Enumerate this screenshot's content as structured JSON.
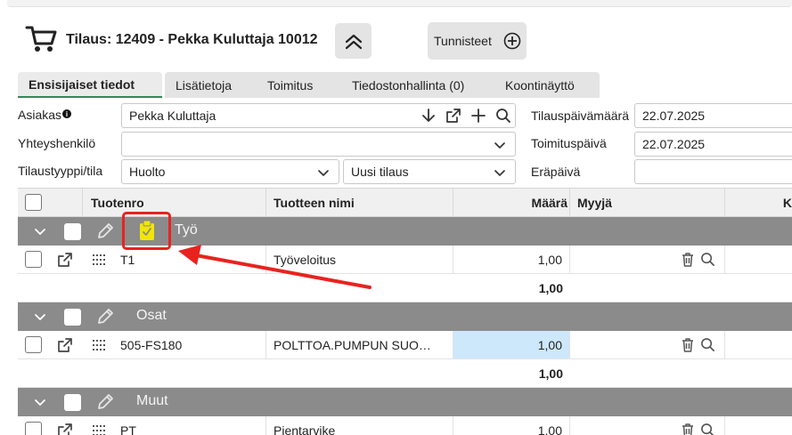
{
  "header": {
    "title": "Tilaus: 12409 - Pekka Kuluttaja 10012",
    "tags_label": "Tunnisteet"
  },
  "tabs": [
    {
      "label": "Ensisijaiset tiedot",
      "active": true
    },
    {
      "label": "Lisätietoja",
      "active": false
    },
    {
      "label": "Toimitus",
      "active": false
    },
    {
      "label": "Tiedostonhallinta (0)",
      "active": false
    },
    {
      "label": "Koontinäyttö",
      "active": false
    }
  ],
  "form": {
    "customer_label": "Asiakas",
    "customer_value": "Pekka Kuluttaja",
    "contact_label": "Yhteyshenkilö",
    "contact_value": "",
    "order_type_label": "Tilaustyyppi/tila",
    "order_type_value": "Huolto",
    "order_status_value": "Uusi tilaus",
    "order_date_label": "Tilauspäivämäärä",
    "order_date_value": "22.07.2025",
    "delivery_date_label": "Toimituspäivä",
    "delivery_date_value": "22.07.2025",
    "due_date_label": "Eräpäivä",
    "due_date_value": ""
  },
  "grid": {
    "columns": {
      "product_no": "Tuotenro",
      "product_name": "Tuotteen nimi",
      "quantity": "Määrä",
      "seller": "Myyjä",
      "extra": "K"
    },
    "groups": [
      {
        "name": "Työ",
        "rows": [
          {
            "product_no": "T1",
            "product_name": "Työveloitus",
            "quantity": "1,00"
          }
        ],
        "total": "1,00"
      },
      {
        "name": "Osat",
        "rows": [
          {
            "product_no": "505-FS180",
            "product_name": "POLTTOA.PUMPUN SUO…",
            "quantity": "1,00"
          }
        ],
        "total": "1,00"
      },
      {
        "name": "Muut",
        "rows": [
          {
            "product_no": "PT",
            "product_name": "Pientarvike",
            "quantity": "1,00"
          }
        ]
      }
    ]
  },
  "colors": {
    "group_bg": "#8b8b8b",
    "annotation": "#e8231f",
    "clipboard_icon": "#f2e600",
    "highlight_cell": "#cde8fb",
    "active_tab_border": "#2e8b57"
  }
}
